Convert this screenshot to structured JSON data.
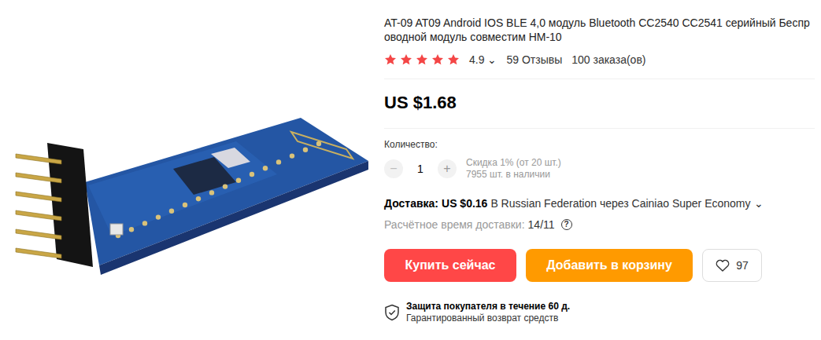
{
  "title": "AT-09 AT09 Android IOS BLE 4,0 модуль Bluetooth CC2540 CC2541 серийный Беспроводной модуль совместим HM-10",
  "rating": {
    "stars": 5,
    "score": "4.9",
    "dropdown_icon": "⌄",
    "reviews": "59 Отзывы",
    "orders": "100 заказа(ов)"
  },
  "price": "US $1.68",
  "quantity": {
    "label": "Количество:",
    "minus": "−",
    "minus_disabled": true,
    "value": "1",
    "plus": "+",
    "discount": "Скидка 1% (от 20 шт.)",
    "stock": "7955 шт. в наличии"
  },
  "shipping": {
    "label": "Доставка:",
    "price": "US $0.16",
    "route": "В Russian Federation через Cainiao Super Economy",
    "dropdown_icon": "⌄",
    "eta_label": "Расчётное время доставки:",
    "eta": "14/11",
    "info_icon": "?"
  },
  "buttons": {
    "buy": "Купить сейчас",
    "cart": "Добавить в корзину",
    "wishlist_count": "97"
  },
  "protection": {
    "title": "Защита покупателя в течение 60 д.",
    "subtitle": "Гарантированный возврат средств"
  }
}
